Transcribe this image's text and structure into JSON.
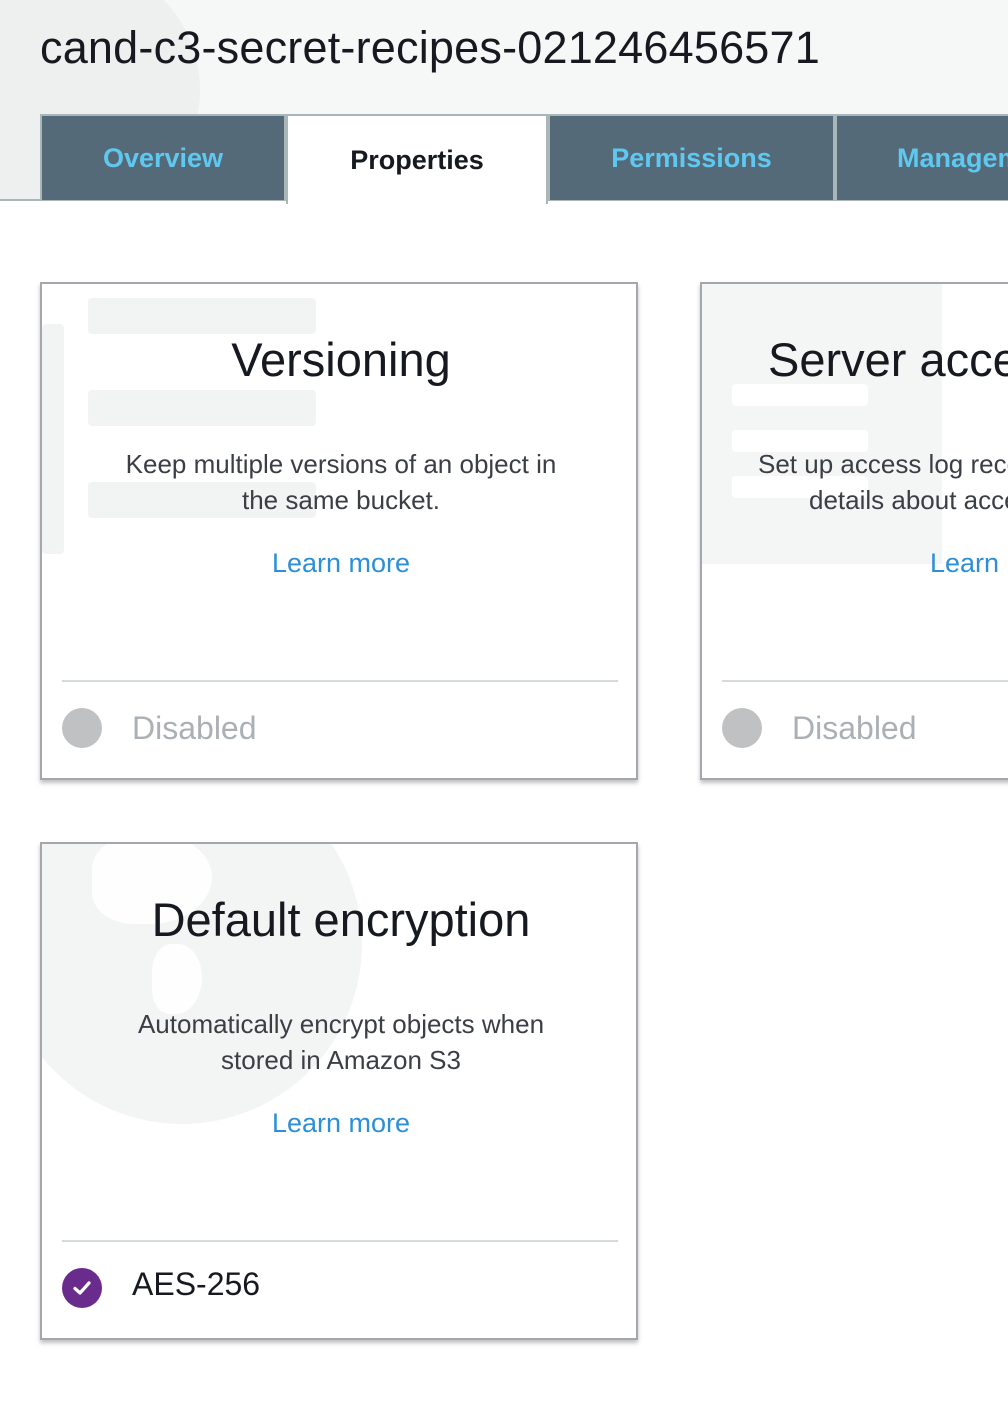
{
  "bucket": {
    "name": "cand-c3-secret-recipes-021246456571"
  },
  "tabs": [
    {
      "label": "Overview",
      "active": false
    },
    {
      "label": "Properties",
      "active": true
    },
    {
      "label": "Permissions",
      "active": false
    },
    {
      "label": "Management",
      "active": false
    }
  ],
  "cards": {
    "versioning": {
      "title": "Versioning",
      "description_line1": "Keep multiple versions of an object in",
      "description_line2": "the same bucket.",
      "link": "Learn more",
      "status": "Disabled"
    },
    "server_access_logging": {
      "title": "Server access logging",
      "description_line1": "Set up access log records that provide",
      "description_line2": "details about access requests.",
      "link": "Learn more",
      "status": "Disabled"
    },
    "default_encryption": {
      "title": "Default encryption",
      "description_line1": "Automatically encrypt objects when",
      "description_line2": "stored in Amazon S3",
      "link": "Learn more",
      "status": "AES-256"
    }
  },
  "colors": {
    "tab_inactive_bg": "#546a79",
    "tab_inactive_text": "#5fc8f0",
    "link": "#2e8fd6",
    "enabled_check": "#6a2c8c",
    "disabled_dot": "#bfc1c3"
  },
  "icons": [
    "check-icon",
    "disabled-status-icon"
  ]
}
